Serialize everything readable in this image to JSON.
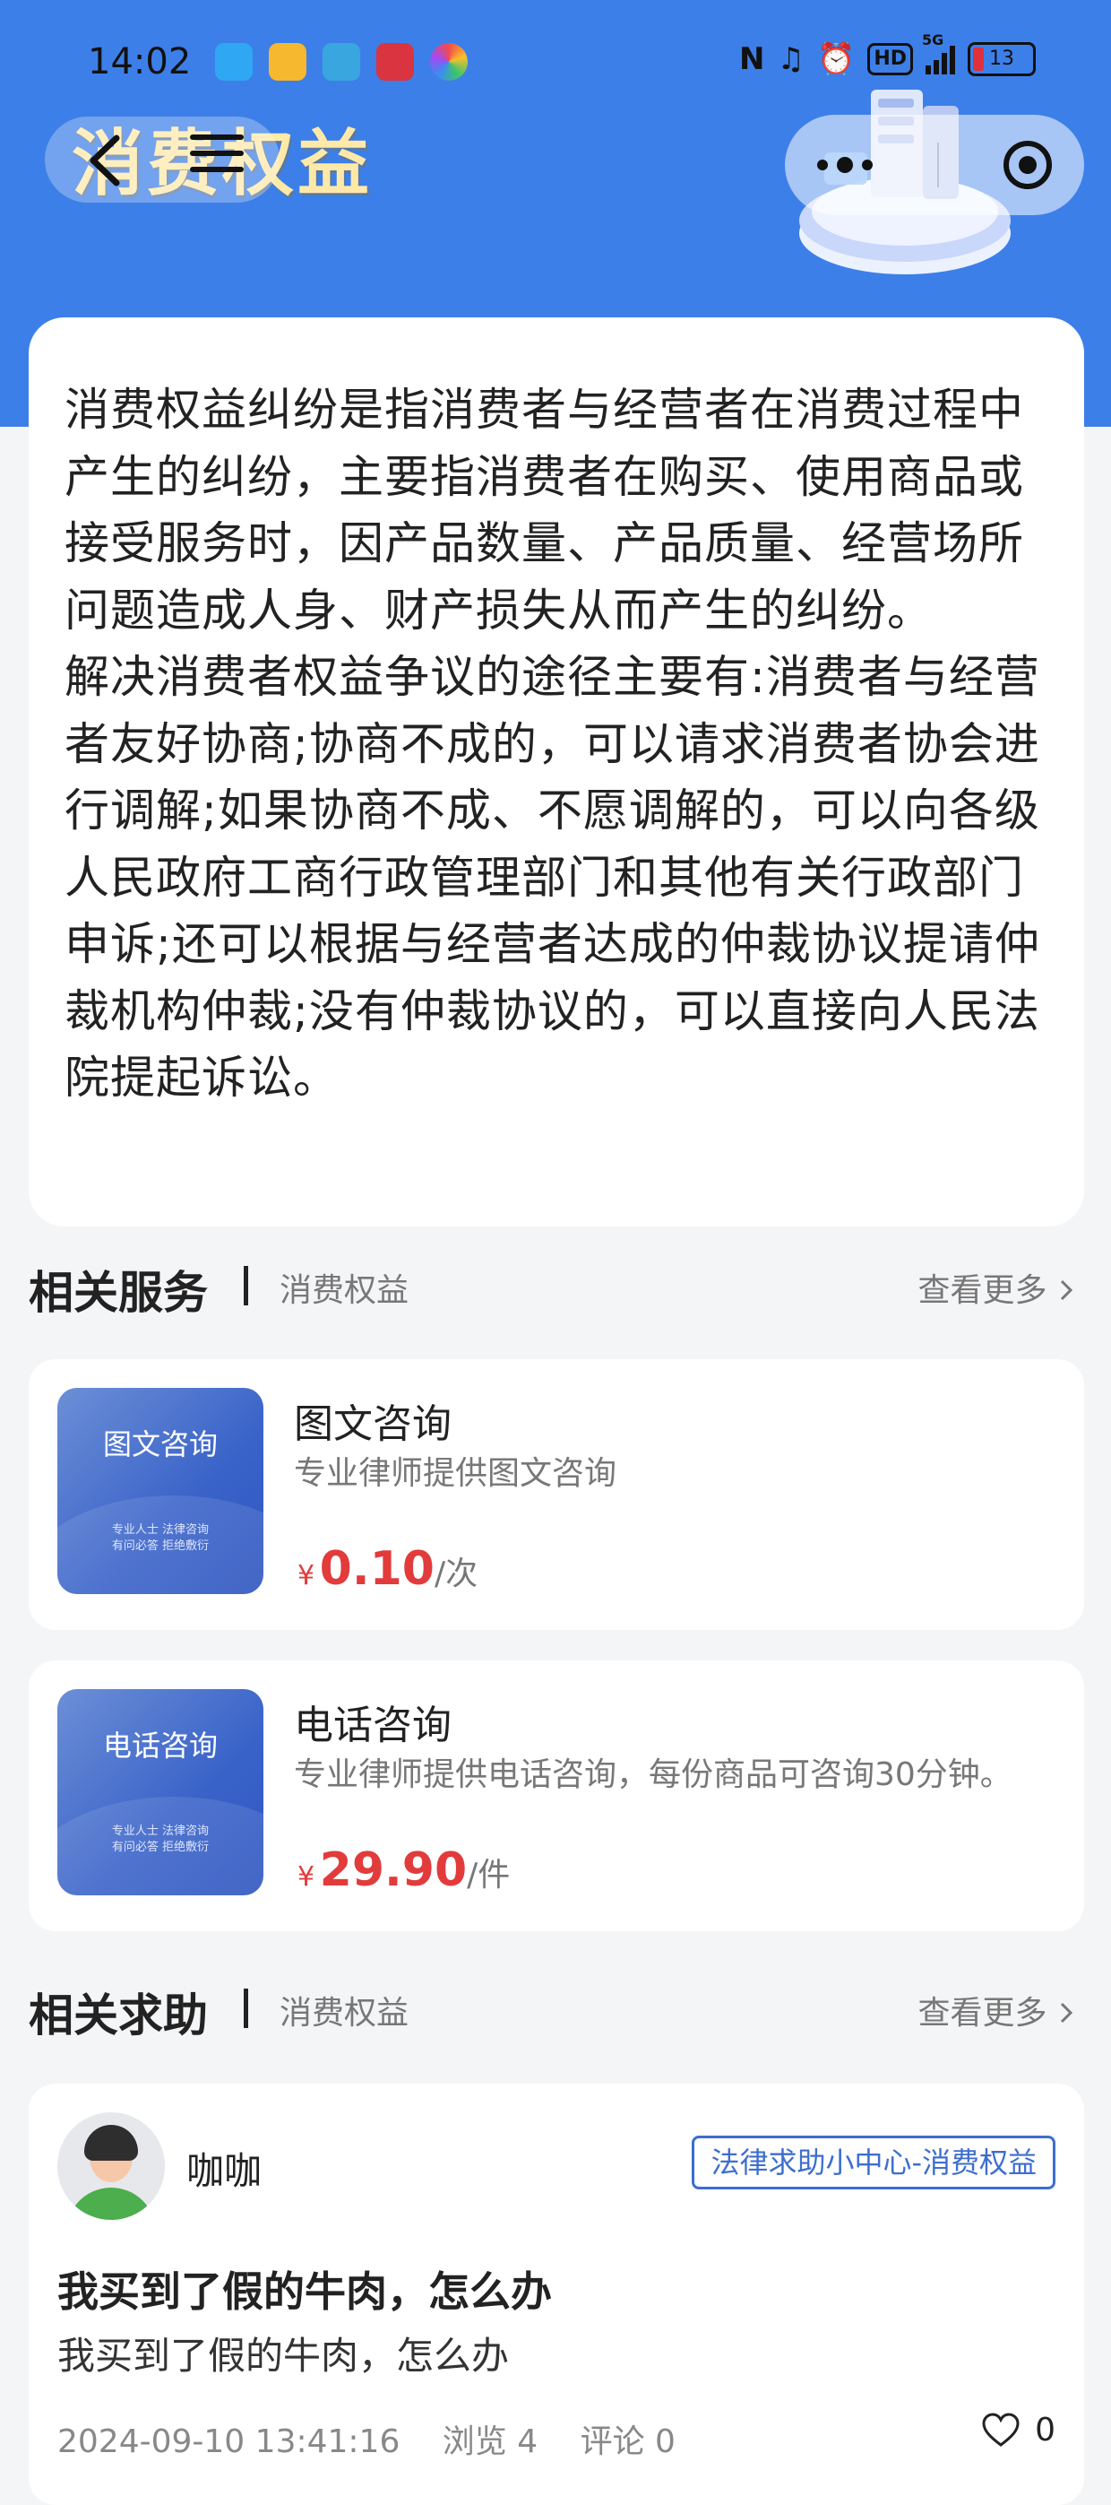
{
  "status_bar": {
    "time": "14:02",
    "network": "5G",
    "hd": "HD",
    "battery": "13"
  },
  "header": {
    "title": "消费权益"
  },
  "intro": {
    "paragraph_1": "消费权益纠纷是指消费者与经营者在消费过程中产生的纠纷，主要指消费者在购买、使用商品或接受服务时，因产品数量、产品质量、经营场所问题造成人身、财产损失从而产生的纠纷。",
    "paragraph_2": "解决消费者权益争议的途径主要有:消费者与经营者友好协商;协商不成的，可以请求消费者协会进行调解;如果协商不成、不愿调解的，可以向各级人民政府工商行政管理部门和其他有关行政部门申诉;还可以根据与经营者达成的仲裁协议提请仲裁机构仲裁;没有仲裁协议的，可以直接向人民法院提起诉讼。"
  },
  "related_services": {
    "title": "相关服务",
    "category": "消费权益",
    "more": "查看更多",
    "items": [
      {
        "thumb_title": "图文咨询",
        "thumb_tag": "专业人士  法律咨询\n有问必答  拒绝敷衍",
        "name": "图文咨询",
        "desc": "专业律师提供图文咨询",
        "currency": "¥",
        "price": "0.10",
        "unit": "/次"
      },
      {
        "thumb_title": "电话咨询",
        "thumb_tag": "专业人士  法律咨询\n有问必答  拒绝敷衍",
        "name": "电话咨询",
        "desc": "专业律师提供电话咨询，每份商品可咨询30分钟。",
        "currency": "¥",
        "price": "29.90",
        "unit": "/件"
      }
    ]
  },
  "related_help": {
    "title": "相关求助",
    "category": "消费权益",
    "more": "查看更多",
    "post": {
      "user": "咖咖",
      "tag": "法律求助小中心-消费权益",
      "title": "我买到了假的牛肉，怎么办",
      "body": "我买到了假的牛肉，怎么办",
      "datetime": "2024-09-10 13:41:16",
      "views": "浏览 4",
      "comments": "评论 0",
      "likes": "0"
    }
  }
}
